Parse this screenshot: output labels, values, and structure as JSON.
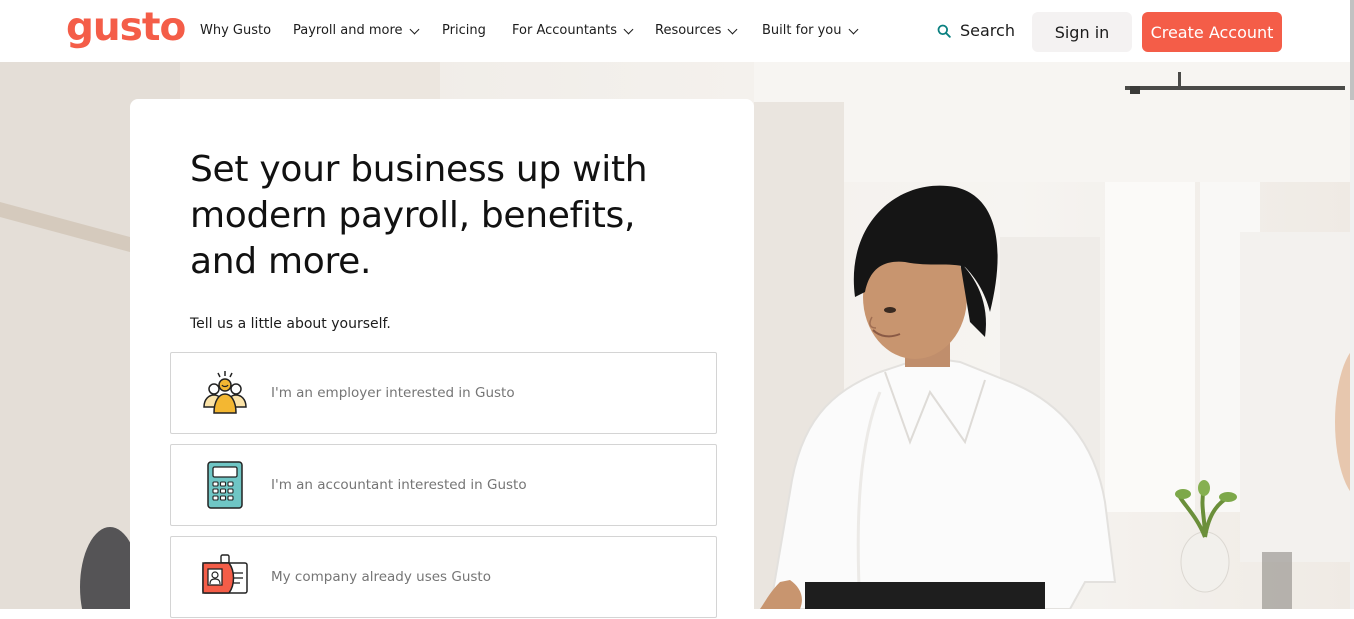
{
  "header": {
    "logo": "gusto",
    "nav": [
      {
        "label": "Why Gusto",
        "dropdown": false
      },
      {
        "label": "Payroll and more",
        "dropdown": true
      },
      {
        "label": "Pricing",
        "dropdown": false
      },
      {
        "label": "For Accountants",
        "dropdown": true
      },
      {
        "label": "Resources",
        "dropdown": true
      },
      {
        "label": "Built for you",
        "dropdown": true
      }
    ],
    "search_label": "Search",
    "signin_label": "Sign in",
    "create_label": "Create Account"
  },
  "hero": {
    "title": "Set your business up with modern payroll, benefits, and more.",
    "subtitle": "Tell us a little about yourself.",
    "options": [
      {
        "label": "I'm an employer interested in Gusto",
        "icon": "team-icon"
      },
      {
        "label": "I'm an accountant interested in Gusto",
        "icon": "calculator-icon"
      },
      {
        "label": "My company already uses Gusto",
        "icon": "id-badge-icon"
      }
    ]
  },
  "colors": {
    "brand": "#f45d48",
    "text": "#1c1c1c",
    "muted": "#757575"
  }
}
